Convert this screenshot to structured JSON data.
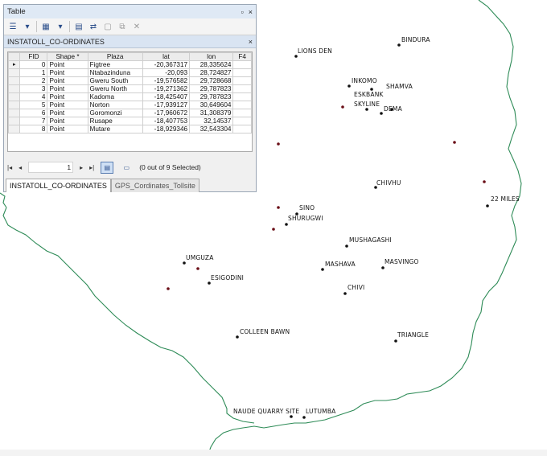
{
  "table_window": {
    "title": "Table",
    "controls": [
      "▫",
      "×"
    ],
    "layer_name": "INSTATOLL_CO-ORDINATES",
    "columns": [
      "FID",
      "Shape *",
      "Plaza",
      "lat",
      "lon",
      "F4"
    ],
    "rows": [
      [
        "0",
        "Point",
        "Figtree",
        "-20,367317",
        "28,335624",
        ""
      ],
      [
        "1",
        "Point",
        "Ntabazinduna",
        "-20,093",
        "28,724827",
        ""
      ],
      [
        "2",
        "Point",
        "Gweru South",
        "-19,576582",
        "29,728668",
        ""
      ],
      [
        "3",
        "Point",
        "Gweru North",
        "-19,271362",
        "29,787823",
        ""
      ],
      [
        "4",
        "Point",
        "Kadoma",
        "-18,425407",
        "29,787823",
        ""
      ],
      [
        "5",
        "Point",
        "Norton",
        "-17,939127",
        "30,649604",
        ""
      ],
      [
        "6",
        "Point",
        "Goromonzi",
        "-17,960672",
        "31,308379",
        ""
      ],
      [
        "7",
        "Point",
        "Rusape",
        "-18,407753",
        "32,14537",
        ""
      ],
      [
        "8",
        "Point",
        "Mutare",
        "-18,929346",
        "32,543304",
        ""
      ]
    ],
    "current_row_marker": "▸",
    "page_value": "1",
    "selection_status": "(0 out of 9 Selected)",
    "tabs": [
      "INSTATOLL_CO-ORDINATES",
      "GPS_Cordinates_Tollsite"
    ]
  },
  "map": {
    "labels": [
      "BINDURA",
      "LIONS DEN",
      "INKOMO",
      "SHAMVA",
      "ESKBANK",
      "SKYLINE",
      "DEMA",
      "CHIVHU",
      "22 MILES",
      "SINO",
      "SHURUGWI",
      "MUSHAGASHI",
      "MASHAVA",
      "MASVINGO",
      "UMGUZA",
      "ESIGODINI",
      "CHIVI",
      "COLLEEN BAWN",
      "TRIANGLE",
      "NAUDE QUARRY SITE",
      "LUTUMBA"
    ],
    "border_color": "#2e8b57",
    "point_color": "#111111",
    "toll_point_color": "#6b0f18"
  }
}
